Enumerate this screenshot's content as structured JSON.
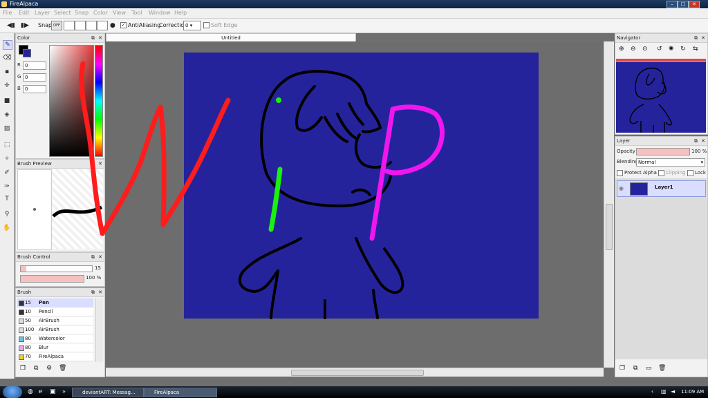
{
  "window": {
    "title": "FireAlpaca"
  },
  "menubar": [
    "File",
    "Edit",
    "Layer",
    "Select",
    "Snap",
    "Color",
    "View",
    "Tool",
    "Window",
    "Help"
  ],
  "toolbar": {
    "snap": "Snap",
    "off": "OFF",
    "antialiasing": "AntiAliasing",
    "correction_label": "Correction",
    "correction_value": "0",
    "soft_edge": "Soft Edge"
  },
  "color_panel": {
    "title": "Color",
    "r_label": "R",
    "r": "0",
    "g_label": "G",
    "g": "0",
    "b_label": "B",
    "b": "0"
  },
  "brush_preview": {
    "title": "Brush Preview"
  },
  "brush_control": {
    "title": "Brush Control",
    "size": "15",
    "opacity": "100 %"
  },
  "brush_panel": {
    "title": "Brush",
    "items": [
      {
        "size": "15",
        "name": "Pen",
        "color": "#333333"
      },
      {
        "size": "10",
        "name": "Pencil",
        "color": "#333333"
      },
      {
        "size": "50",
        "name": "AirBrush",
        "color": "#dddddd"
      },
      {
        "size": "100",
        "name": "AirBrush",
        "color": "#dddddd"
      },
      {
        "size": "80",
        "name": "Watercolor",
        "color": "#60c8e8"
      },
      {
        "size": "80",
        "name": "Blur",
        "color": "#e8b0e0"
      },
      {
        "size": "70",
        "name": "FireAlpaca",
        "color": "#f0d020"
      }
    ]
  },
  "document": {
    "tab": "Untitled",
    "bg_color": "#25239c"
  },
  "navigator": {
    "title": "Navigator"
  },
  "layer_panel": {
    "title": "Layer",
    "opacity_label": "Opacity",
    "opacity": "100 %",
    "blending_label": "Blending",
    "blending": "Normal",
    "protect_alpha": "Protect Alpha",
    "clipping": "Clipping",
    "lock": "Lock",
    "layer_name": "Layer1"
  },
  "taskbar": {
    "item1": "deviantART: Messag...",
    "item2": "FireAlpaca",
    "time": "11:09 AM"
  }
}
